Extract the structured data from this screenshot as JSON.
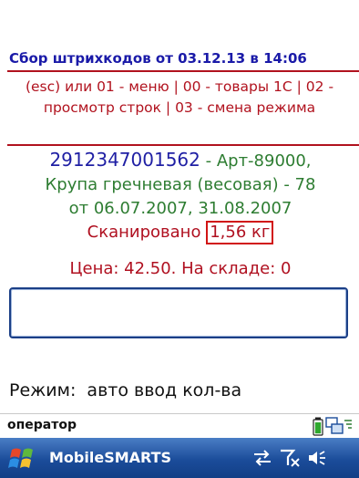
{
  "header": {
    "title": "Сбор штрихкодов от 03.12.13 в 14:06"
  },
  "help": {
    "text": "(esc) или 01 - меню | 00 - товары 1С | 02 - просмотр строк | 03 - смена режима"
  },
  "scan": {
    "barcode": "2912347001562",
    "barcode_sep": " - ",
    "article": "Арт-89000,",
    "product": "Крупа гречневая (весовая) - 78",
    "dates": "от 06.07.2007, 31.08.2007",
    "scanned_label": "Сканировано",
    "scanned_value": "1,56 кг",
    "price_line": "Цена: 42.50. На складе: 0"
  },
  "input": {
    "value": ""
  },
  "mode": {
    "text": "Режим:  авто ввод кол-ва"
  },
  "status": {
    "operator": "оператор"
  },
  "taskbar": {
    "app_name": "MobileSMARTS"
  },
  "icons": {
    "battery": "battery-icon",
    "connection": "connection-icon",
    "start": "windows-start-icon",
    "sync": "sync-arrows-icon",
    "signal": "signal-off-icon",
    "volume": "volume-icon"
  },
  "colors": {
    "title_blue": "#1a1aa8",
    "accent_red": "#b1121e",
    "product_green": "#2e7d32",
    "taskbar_blue": "#1b4c9a"
  }
}
